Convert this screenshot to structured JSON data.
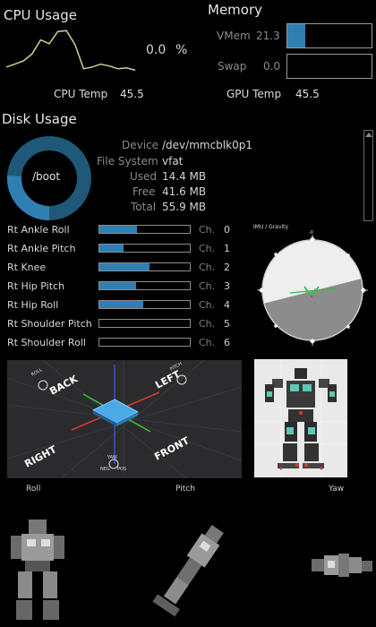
{
  "cpu": {
    "title": "CPU Usage",
    "value": "0.0",
    "unit": "%",
    "temp_label": "CPU Temp",
    "temp_value": "45.5",
    "history": [
      12,
      18,
      25,
      40,
      70,
      62,
      88,
      90,
      60,
      8,
      12,
      18,
      14,
      8,
      10,
      5
    ]
  },
  "memory": {
    "title": "Memory",
    "vmem_label": "VMem",
    "vmem_value": "21.3",
    "vmem_fraction": 0.21,
    "swap_label": "Swap",
    "swap_value": "0.0",
    "swap_fraction": 0.0,
    "gpu_temp_label": "GPU Temp",
    "gpu_temp_value": "45.5"
  },
  "disk": {
    "title": "Disk Usage",
    "mount": "/boot",
    "used_fraction": 0.26,
    "device_label": "Device",
    "device_value": "/dev/mmcblk0p1",
    "fs_label": "File System",
    "fs_value": "vfat",
    "used_label": "Used",
    "used_value": "14.4 MB",
    "free_label": "Free",
    "free_value": "41.6 MB",
    "total_label": "Total",
    "total_value": "55.9 MB"
  },
  "joints": {
    "ch_label": "Ch.",
    "items": [
      {
        "name": "Rt Ankle Roll",
        "ch": "0",
        "fill": 0.42
      },
      {
        "name": "Rt Ankle Pitch",
        "ch": "1",
        "fill": 0.27
      },
      {
        "name": "Rt Knee",
        "ch": "2",
        "fill": 0.55
      },
      {
        "name": "Rt Hip Pitch",
        "ch": "3",
        "fill": 0.41
      },
      {
        "name": "Rt Hip Roll",
        "ch": "4",
        "fill": 0.49
      },
      {
        "name": "Rt Shoulder Pitch",
        "ch": "5",
        "fill": 0.0
      },
      {
        "name": "Rt Shoulder Roll",
        "ch": "6",
        "fill": 0.0
      }
    ]
  },
  "imu": {
    "title": "IMU / Gravity",
    "top_tick": "-0"
  },
  "orientation": {
    "back": "BACK",
    "left": "LEFT",
    "right": "RIGHT",
    "front": "FRONT",
    "roll_marker": "ROLL",
    "pitch_marker": "PITCH",
    "yaw_marker": "YAW",
    "neg": "NEG",
    "pos": "POS"
  },
  "captions": {
    "roll": "Roll",
    "pitch": "Pitch",
    "yaw": "Yaw"
  },
  "colors": {
    "accent": "#2f7fb3",
    "accent_dark": "#1f5878"
  }
}
